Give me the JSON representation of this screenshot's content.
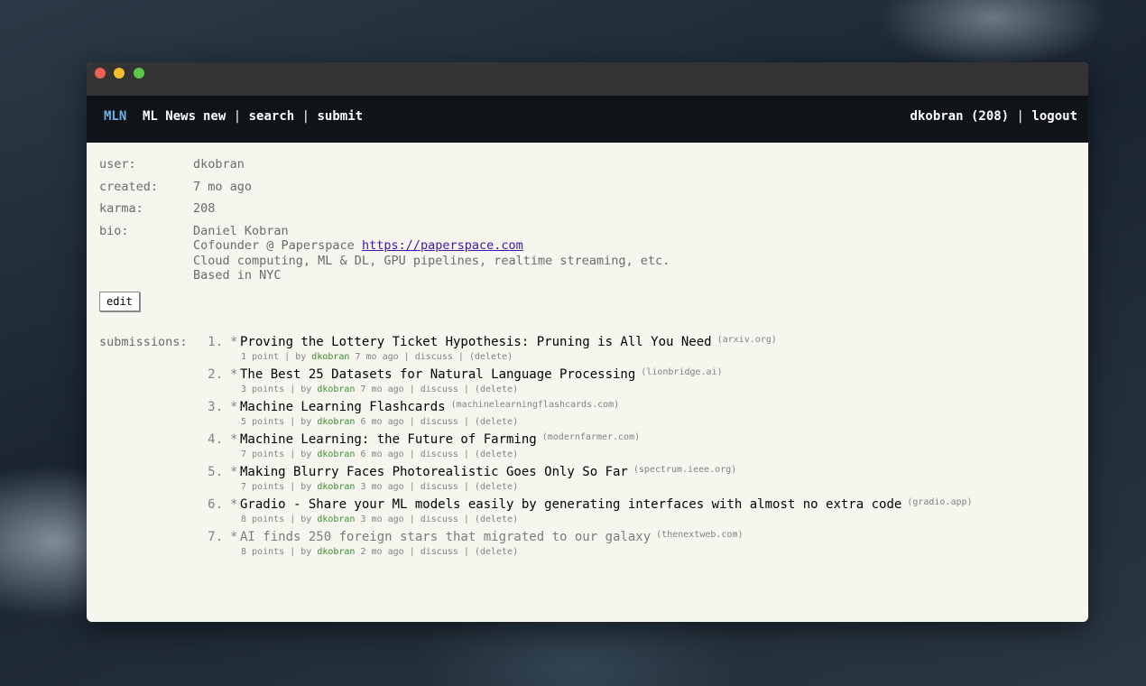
{
  "nav": {
    "logo": "MLN",
    "brand": "ML News",
    "links": [
      "new",
      "search",
      "submit"
    ],
    "user": "dkobran (208)",
    "logout": "logout"
  },
  "profile": {
    "user_label": "user:",
    "user": "dkobran",
    "created_label": "created:",
    "created": "7 mo ago",
    "karma_label": "karma:",
    "karma": "208",
    "bio_label": "bio:",
    "bio_line1": "Daniel Kobran",
    "bio_line2_prefix": "Cofounder @ Paperspace ",
    "bio_link": "https://paperspace.com",
    "bio_line3": "Cloud computing, ML & DL, GPU pipelines, realtime streaming, etc.",
    "bio_line4": "Based in NYC",
    "edit": "edit"
  },
  "submissions_label": "submissions:",
  "submissions": [
    {
      "num": "1.",
      "title": "Proving the Lottery Ticket Hypothesis: Pruning is All You Need",
      "domain": "(arxiv.org)",
      "points": "1 point",
      "by": "by",
      "user": "dkobran",
      "age": "7 mo ago",
      "discuss": "discuss",
      "delete": "(delete)"
    },
    {
      "num": "2.",
      "title": "The Best 25 Datasets for Natural Language Processing",
      "domain": "(lionbridge.ai)",
      "points": "3 points",
      "by": "by",
      "user": "dkobran",
      "age": "7 mo ago",
      "discuss": "discuss",
      "delete": "(delete)"
    },
    {
      "num": "3.",
      "title": "Machine Learning Flashcards",
      "domain": "(machinelearningflashcards.com)",
      "points": "5 points",
      "by": "by",
      "user": "dkobran",
      "age": "6 mo ago",
      "discuss": "discuss",
      "delete": "(delete)"
    },
    {
      "num": "4.",
      "title": "Machine Learning: the Future of Farming",
      "domain": "(modernfarmer.com)",
      "points": "7 points",
      "by": "by",
      "user": "dkobran",
      "age": "6 mo ago",
      "discuss": "discuss",
      "delete": "(delete)"
    },
    {
      "num": "5.",
      "title": "Making Blurry Faces Photorealistic Goes Only So Far",
      "domain": "(spectrum.ieee.org)",
      "points": "7 points",
      "by": "by",
      "user": "dkobran",
      "age": "3 mo ago",
      "discuss": "discuss",
      "delete": "(delete)"
    },
    {
      "num": "6.",
      "title": "Gradio - Share your ML models easily by generating interfaces with almost no extra code",
      "domain": "(gradio.app)",
      "points": "8 points",
      "by": "by",
      "user": "dkobran",
      "age": "3 mo ago",
      "discuss": "discuss",
      "delete": "(delete)"
    },
    {
      "num": "7.",
      "title": "AI finds 250 foreign stars that migrated to our galaxy",
      "domain": "(thenextweb.com)",
      "points": "8 points",
      "by": "by",
      "user": "dkobran",
      "age": "2 mo ago",
      "discuss": "discuss",
      "delete": "(delete)"
    }
  ]
}
